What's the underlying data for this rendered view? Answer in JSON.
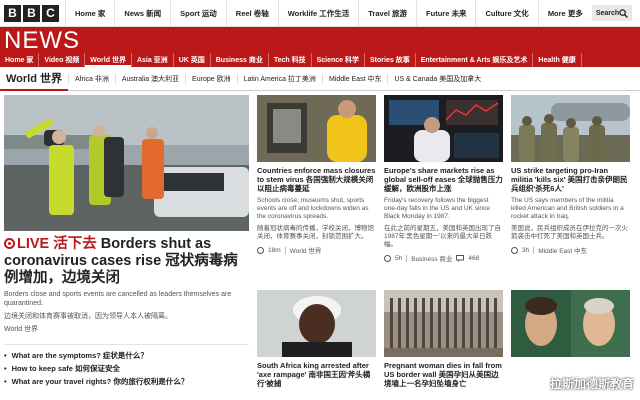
{
  "global_nav": [
    "Home 家",
    "News 新闻",
    "Sport 运动",
    "Reel 卷轴",
    "Worklife 工作生活",
    "Travel 旅游",
    "Future 未来",
    "Culture 文化",
    "More 更多"
  ],
  "search": {
    "label": "Search"
  },
  "brand": {
    "logo_letters": [
      "B",
      "B",
      "C"
    ],
    "news": "NEWS"
  },
  "section_nav": [
    "Home 家",
    "Video 视频",
    "World 世界",
    "Asia 亚洲",
    "UK 英国",
    "Business 商业",
    "Tech 科技",
    "Science 科学",
    "Stories 故事",
    "Entertainment & Arts 娱乐及艺术",
    "Health 健康"
  ],
  "subnav": {
    "current": "World 世界",
    "items": [
      "Africa 非洲",
      "Australia 澳大利亚",
      "Europe 欧洲",
      "Latin America 拉丁美洲",
      "Middle East 中东",
      "US & Canada 美国及加拿大"
    ]
  },
  "lead": {
    "live": "LIVE 活下去",
    "title": "Borders shut as coronavirus cases rise 冠状病毒病例增加，边境关闭",
    "summary": "Borders close and sports events are cancelled as leaders themselves are quarantined.",
    "summary_zh": "边境关闭和体育赛事被取消，因为领导人本人被隔离。",
    "tag": "World 世界",
    "bullets": [
      "What are the symptoms? 症状是什么？",
      "How to keep safe 如何保证安全",
      "What are your travel rights? 你的旅行权利是什么？"
    ]
  },
  "cards": [
    {
      "title": "Countries enforce mass closures to stem virus 各国强制大规模关闭以阻止病毒蔓延",
      "summary": "Schools close, museums shut, sports events are off and lockdowns widen as the coronavirus spreads.",
      "summary_zh": "随着冠状病毒的传播，学校关闭，博物馆关闭，体育赛事关闭，封锁范围扩大。",
      "time": "18m",
      "section": "World 世界",
      "comments": ""
    },
    {
      "title": "Europe's share markets rise as global sell-off eases 全球抛售压力缓解，欧洲股市上涨",
      "summary": "Friday's recovery follows the biggest one-day falls in the US and UK since Black Monday in 1987.",
      "summary_zh": "在此之前的星期五，美国和英国出现了自1987年'黑色星期一'以来的最大单日跌幅。",
      "time": "5h",
      "section": "Business 商业",
      "comments": "468"
    },
    {
      "title": "US strike targeting pro-Iran militia 'kills six' 美国打击亲伊朗民兵组织'杀死6人'",
      "summary": "The US says members of the militia killed American and British soldiers in a rocket attack in Iraq.",
      "summary_zh": "美国说，民兵组织成员在伊拉克的一次火箭袭击中打死了美国和英国士兵。",
      "time": "3h",
      "section": "Middle East 中东",
      "comments": ""
    },
    {
      "title": "South Africa king arrested after 'axe rampage' 南非国王因'斧头横行'被捕",
      "summary": "",
      "summary_zh": "",
      "time": "",
      "section": "",
      "comments": ""
    },
    {
      "title": "Pregnant woman dies in fall from US border wall 美国孕妇从美国边境墙上一名孕妇坠墙身亡",
      "summary": "",
      "summary_zh": "",
      "time": "",
      "section": "",
      "comments": ""
    },
    {
      "title": "",
      "summary": "",
      "summary_zh": "",
      "time": "",
      "section": "",
      "comments": ""
    }
  ],
  "watermark": "拉斯加德斯教育"
}
